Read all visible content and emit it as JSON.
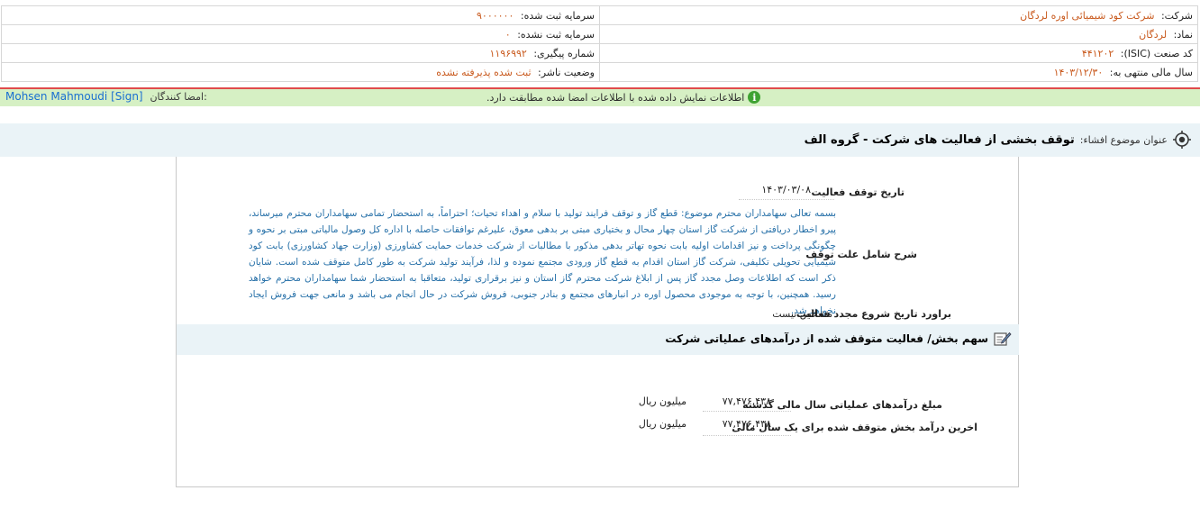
{
  "info": {
    "company_label": "شرکت:",
    "company_value": "شرکت کود شیمیائی اوره لردگان",
    "registered_capital_label": "سرمایه ثبت شده:",
    "registered_capital_value": "۹۰۰۰۰۰۰",
    "symbol_label": "نماد:",
    "symbol_value": "لردگان",
    "unregistered_capital_label": "سرمایه ثبت نشده:",
    "unregistered_capital_value": "۰",
    "isic_label": "کد صنعت (ISIC):",
    "isic_value": "۴۴۱۲۰۲",
    "tracking_label": "شماره پیگیری:",
    "tracking_value": "۱۱۹۶۹۹۲",
    "fiscal_year_label": "سال مالی منتهی به:",
    "fiscal_year_value": "۱۴۰۳/۱۲/۳۰",
    "publisher_status_label": "وضعیت ناشر:",
    "publisher_status_value": "ثبت شده پذیرفته نشده"
  },
  "notice": {
    "message": "اطلاعات نمایش داده شده با اطلاعات امضا شده مطابقت دارد.",
    "signers_label": "امضا کنندگان:",
    "signer": "Mohsen Mahmoudi [Sign]"
  },
  "title": {
    "label": "عنوان موضوع افشاء:",
    "text": "توقف بخشی از فعالیت های شرکت - گروه الف"
  },
  "details": {
    "stop_date_label": "تاریخ توقف فعالیت",
    "stop_date_value": "۱۴۰۳/۰۳/۰۸",
    "reason_label": "شرح شامل علت توقف",
    "reason_text": "بسمه تعالی سهامداران محترم موضوع: قطع گاز و توقف فرایند تولید با سلام و اهداء تحیات؛ احتراماً، به استحضار تمامی سهامداران محترم میرساند، پیرو اخطار دریافتی از شرکت گاز استان چهار محال و بختیاری مبتی بر بدهی معوق، علیرغم توافقات حاصله با اداره کل وصول مالیاتی مبتی بر نحوه و چگونگی پرداخت و نیز اقدامات اولیه بابت نحوه تهاتر بدهی مذکور با مطالبات از شرکت خدمات حمایت کشاورزی (وزارت جهاد کشاورزی) بابت کود شیمیایی تحویلی تکلیفی، شرکت گاز استان اقدام به قطع گاز ورودی مجتمع نموده و لذا، فرآیند تولید شرکت به طور کامل متوقف شده است. شایان ذکر است که اطلاعات وصل مجدد گاز پس از ابلاغ شرکت محترم گاز استان و نیز برقراری تولید، متعاقبا به استحضار شما سهامداران محترم خواهد رسید. همچنین، با توجه به موجودی محصول اوره در انبارهای مجتمع و بنادر جنوبی، فروش شرکت در حال انجام می باشد و مانعی جهت فروش ایجاد نخواهد شد.",
    "restart_label": "براورد تاریخ شروع مجدد فعالیت",
    "restart_value": "مشخص نیست"
  },
  "section": {
    "title": "سهم بخش/ فعالیت متوقف شده از درآمدهای عملیاتی شرکت",
    "prev_year_label": "مبلغ درآمدهای عملیاتی سال مالی گذشته",
    "prev_year_value": "۷۷,۴۷۶,۴۳۸",
    "prev_year_unit": "میلیون ریال",
    "last_year_label": "اخرین درآمد بخش متوقف شده برای یک سال مالی",
    "last_year_value": "۷۷,۴۷۶,۴۳۸",
    "last_year_unit": "میلیون ریال"
  },
  "colors": {
    "accent_orange": "#c95a1e",
    "desc_blue": "#2670a8",
    "signer_blue": "#1a6fd1",
    "notice_green": "#d6f0c4",
    "band_blue": "#eaf3f7",
    "red_rule": "#e04a4a"
  },
  "icons": {
    "notice": "info-icon",
    "title": "target-icon",
    "section": "edit-icon"
  }
}
